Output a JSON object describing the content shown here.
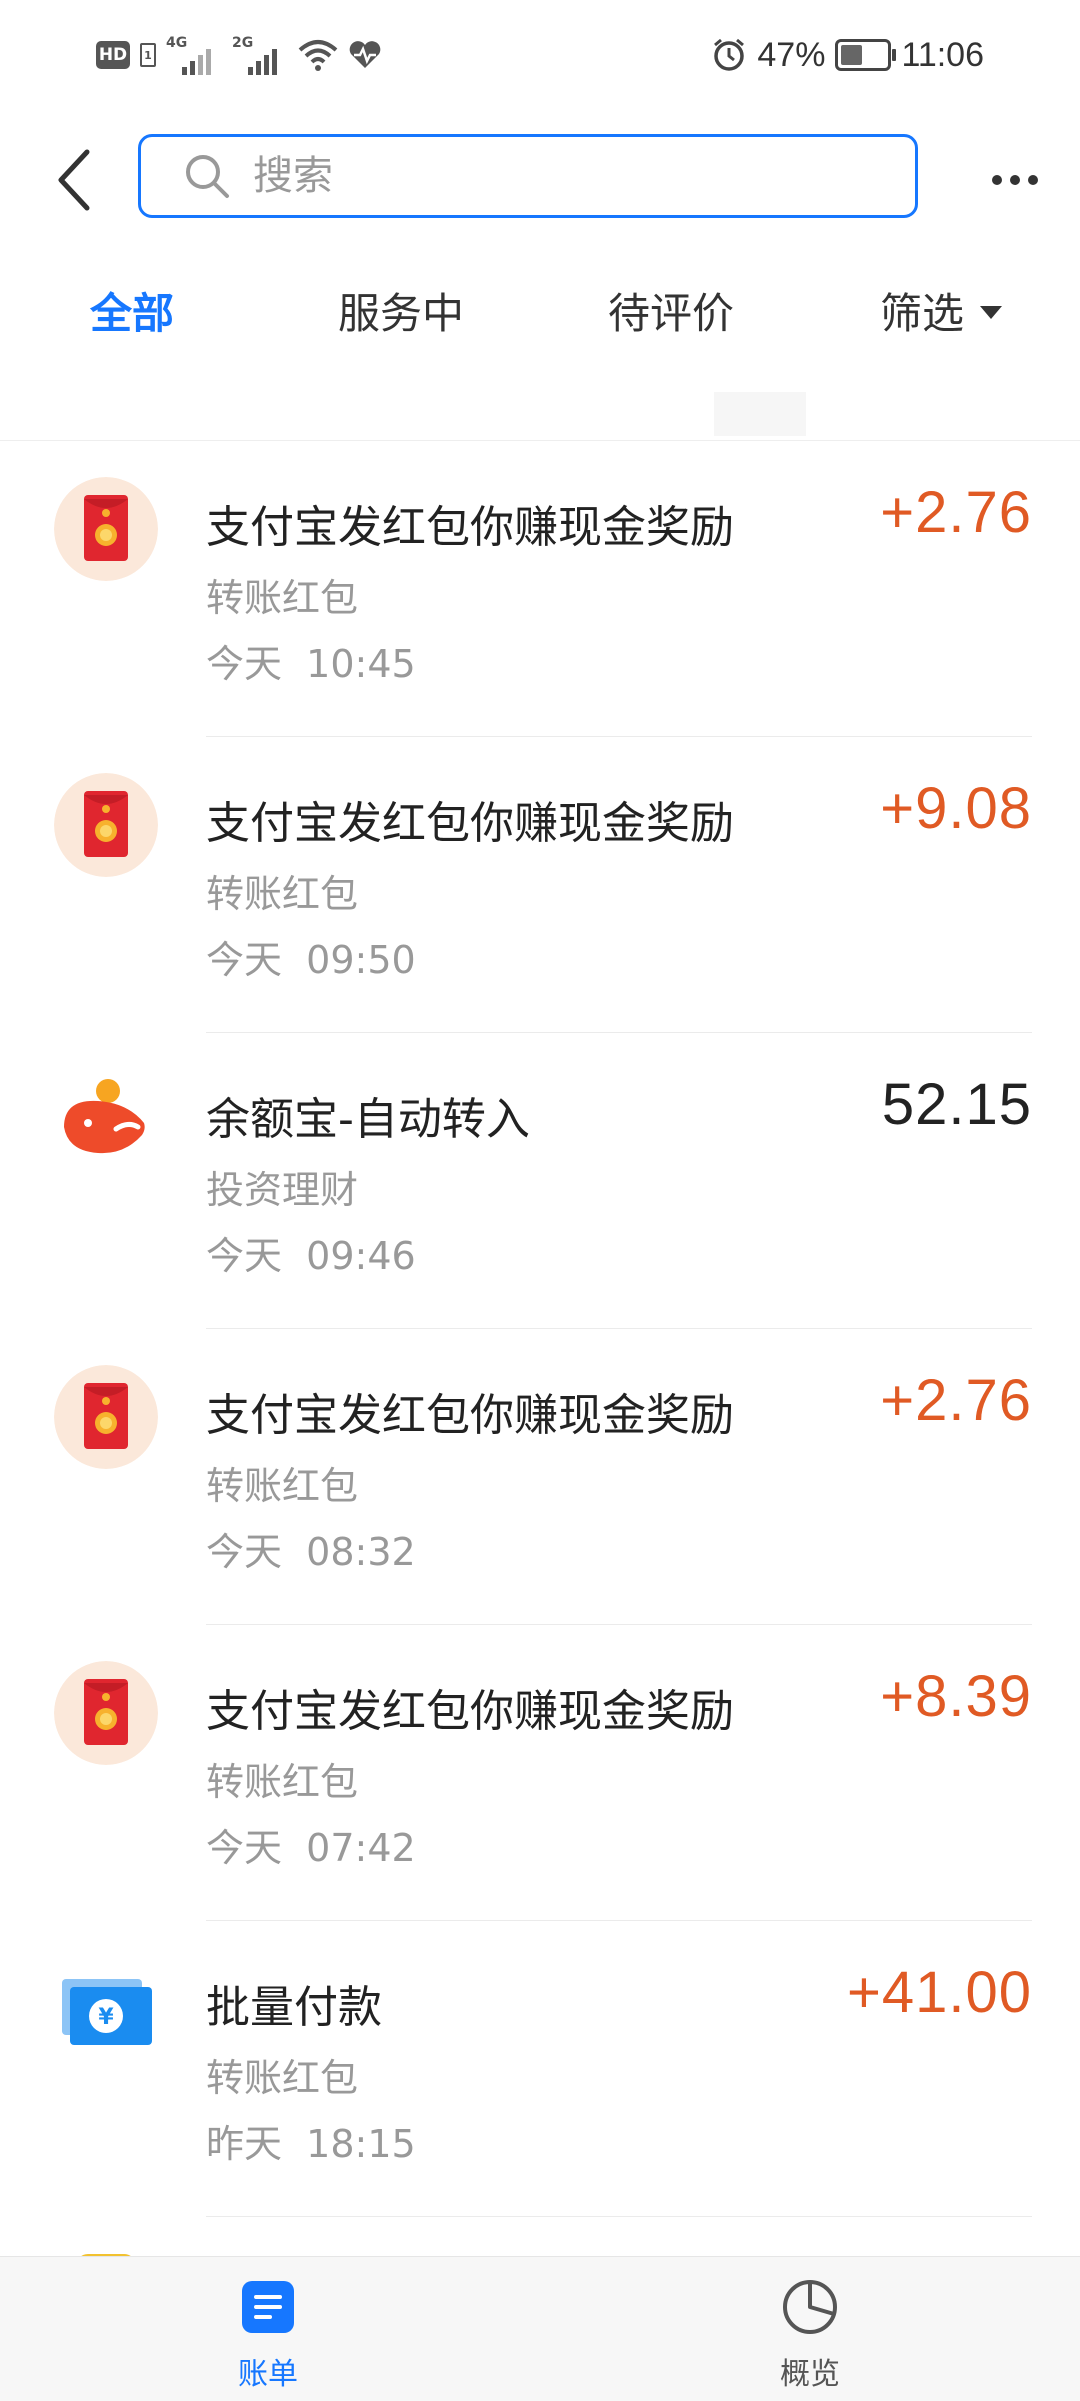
{
  "status_bar": {
    "hd_label": "HD",
    "sim_label": "1",
    "network_1": "4G",
    "network_2": "2G",
    "battery_percent": "47%",
    "battery_level": 0.47,
    "time": "11:06",
    "icons": [
      "hd-icon",
      "signal-icon",
      "wifi-icon",
      "heart-monitor-icon",
      "alarm-icon",
      "battery-icon"
    ]
  },
  "header": {
    "search_placeholder": "搜索",
    "icons": {
      "back": "chevron-left-icon",
      "search": "search-icon",
      "more": "more-dots-icon"
    }
  },
  "tabs": [
    {
      "label": "全部",
      "active": true
    },
    {
      "label": "服务中",
      "active": false
    },
    {
      "label": "待评价",
      "active": false
    },
    {
      "label": "筛选",
      "active": false,
      "has_dropdown": true
    }
  ],
  "transactions": [
    {
      "icon": "red-envelope-icon",
      "title": "支付宝发红包你赚现金奖励",
      "category": "转账红包",
      "time": "今天  10:45",
      "amount": "+2.76",
      "type": "income"
    },
    {
      "icon": "red-envelope-icon",
      "title": "支付宝发红包你赚现金奖励",
      "category": "转账红包",
      "time": "今天  09:50",
      "amount": "+9.08",
      "type": "income"
    },
    {
      "icon": "yuebao-icon",
      "title": "余额宝-自动转入",
      "category": "投资理财",
      "time": "今天  09:46",
      "amount": "52.15",
      "type": "neutral"
    },
    {
      "icon": "red-envelope-icon",
      "title": "支付宝发红包你赚现金奖励",
      "category": "转账红包",
      "time": "今天  08:32",
      "amount": "+2.76",
      "type": "income"
    },
    {
      "icon": "red-envelope-icon",
      "title": "支付宝发红包你赚现金奖励",
      "category": "转账红包",
      "time": "今天  07:42",
      "amount": "+8.39",
      "type": "income"
    },
    {
      "icon": "batch-payment-icon",
      "title": "批量付款",
      "category": "转账红包",
      "time": "昨天  18:15",
      "amount": "+41.00",
      "type": "income"
    }
  ],
  "bottom_nav": [
    {
      "label": "账单",
      "icon": "bill-icon",
      "active": true
    },
    {
      "label": "概览",
      "icon": "pie-chart-icon",
      "active": false
    }
  ],
  "colors": {
    "accent": "#1677ff",
    "income": "#e05a24",
    "text_primary": "#222222",
    "text_secondary": "#999999"
  }
}
